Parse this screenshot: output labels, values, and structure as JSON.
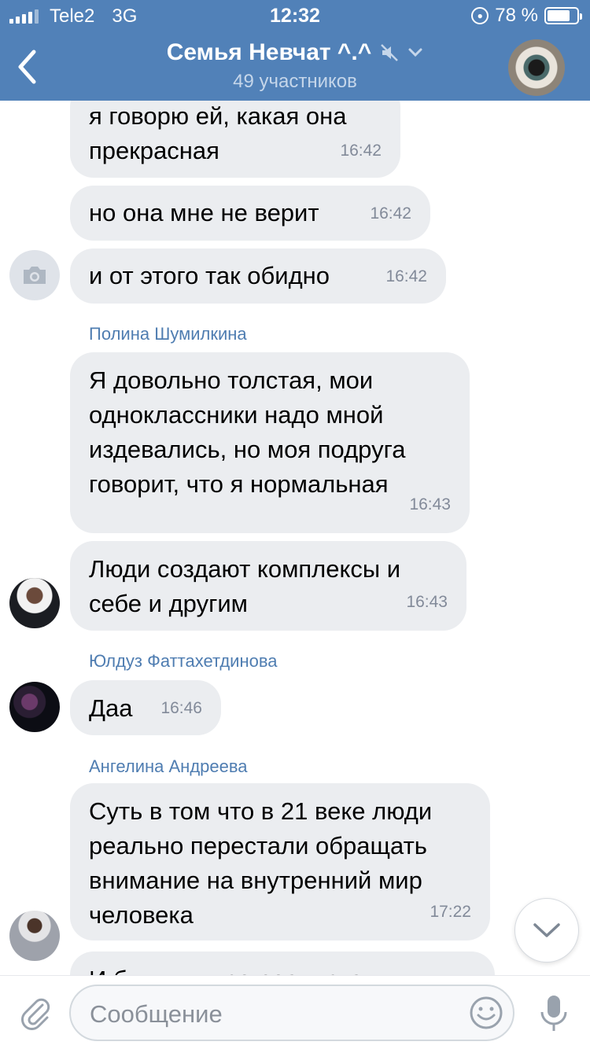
{
  "status_bar": {
    "carrier": "Tele2",
    "network": "3G",
    "time": "12:32",
    "battery": "78 %",
    "battery_level": 0.78
  },
  "header": {
    "title": "Семья Невчат ^.^",
    "subtitle": "49 участников"
  },
  "messages": [
    {
      "text": "я говорю ей, какая она\nпрекрасная",
      "time": "16:42"
    },
    {
      "text": "но она мне не верит",
      "time": "16:42"
    },
    {
      "text": "и от этого так обидно",
      "time": "16:42"
    },
    {
      "sender": "Полина Шумилкина"
    },
    {
      "text": "Я довольно толстая, мои\nодноклассники надо мной\nиздевались, но моя подруга\nговорит, что я нормальная",
      "time": "16:43"
    },
    {
      "text": "Люди создают комплексы и\nсебе и другим",
      "time": "16:43"
    },
    {
      "sender": "Юлдуз Фаттахетдинова"
    },
    {
      "text": "Даа",
      "time": "16:46"
    },
    {
      "sender": "Ангелина Андреева"
    },
    {
      "text": "Суть в том что в 21 веке люди\nреально перестали обращать\nвнимание на внутренний мир\nчеловека",
      "time": "17:22"
    },
    {
      "text": "И будь мы все реалистами"
    }
  ],
  "composer": {
    "placeholder": "Сообщение"
  },
  "colors": {
    "header_bg": "#5181b8",
    "bubble_bg": "#ebedf0",
    "sender_name": "#4f7db1",
    "time_text": "#828a99"
  },
  "icons": [
    "back-chevron-icon",
    "mute-icon",
    "chevron-down-icon",
    "camera-icon",
    "scroll-down-icon",
    "paperclip-icon",
    "emoji-icon",
    "microphone-icon"
  ]
}
